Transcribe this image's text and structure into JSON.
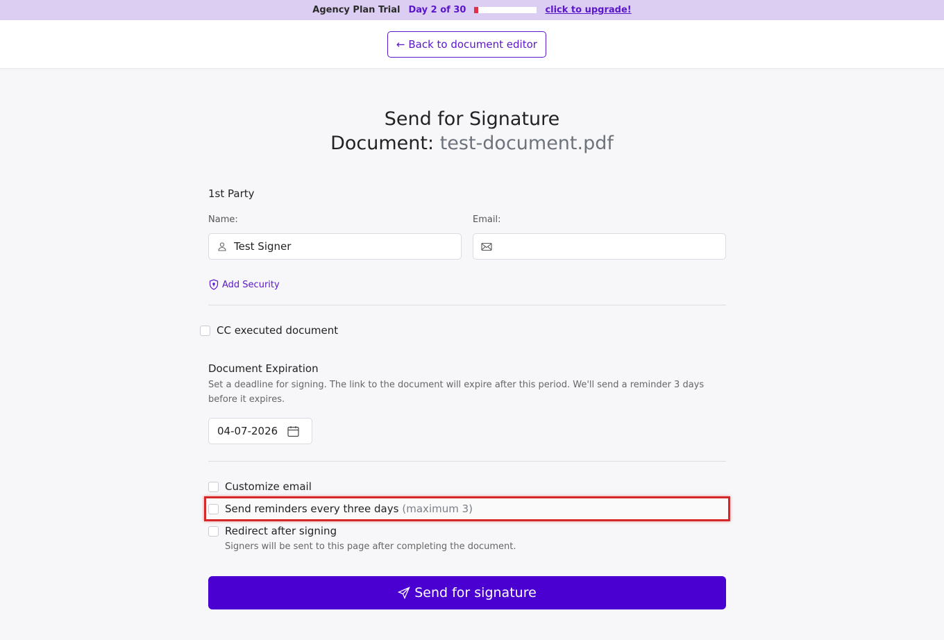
{
  "trial_bar": {
    "plan": "Agency Plan Trial",
    "day": "Day 2 of 30",
    "progress_fraction": 0.0667,
    "progress_color": "#e0304a",
    "upgrade_link": "click to upgrade!"
  },
  "header": {
    "back_button": "← Back to document editor"
  },
  "title": {
    "line1": "Send for Signature",
    "doc_label": "Document:",
    "doc_name": "test-document.pdf"
  },
  "party": {
    "heading": "1st Party",
    "name_label": "Name:",
    "name_value": "Test Signer",
    "email_label": "Email:",
    "email_value": "",
    "add_security": "Add Security"
  },
  "cc": {
    "label": "CC executed document"
  },
  "expiration": {
    "heading": "Document Expiration",
    "description": "Set a deadline for signing. The link to the document will expire after this period. We'll send a reminder 3 days before it expires.",
    "date": "04-07-2026"
  },
  "options": {
    "customize_email": "Customize email",
    "reminders": "Send reminders every three days",
    "reminders_note": "(maximum 3)",
    "redirect": "Redirect after signing",
    "redirect_desc": "Signers will be sent to this page after completing the document."
  },
  "send_button": "Send for signature",
  "colors": {
    "accent": "#5a16c9",
    "send_button": "#4a00d0",
    "trial_bar": "#dccdf3",
    "highlight": "#d62828"
  }
}
